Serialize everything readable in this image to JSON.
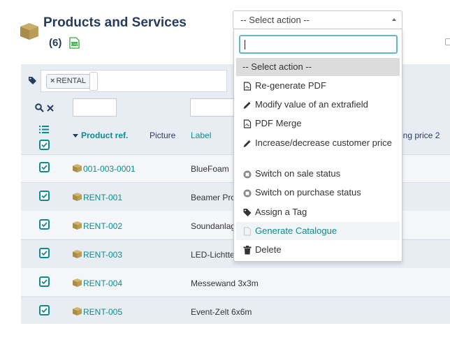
{
  "page": {
    "title": "Products and Services",
    "count": "(6)"
  },
  "select_action": {
    "placeholder": "-- Select action --"
  },
  "dropdown": {
    "items": [
      {
        "label": "-- Select action --",
        "icon": "none"
      },
      {
        "label": "Re-generate PDF",
        "icon": "pdf-file-icon"
      },
      {
        "label": "Modify value of an extrafield",
        "icon": "pencil-icon"
      },
      {
        "label": "PDF Merge",
        "icon": "pdf-file-icon"
      },
      {
        "label": "Increase/decrease customer price",
        "icon": "pencil-icon"
      },
      {
        "label": "Switch on sale status",
        "icon": "toggle-circle-icon"
      },
      {
        "label": "Switch on purchase status",
        "icon": "toggle-circle-icon"
      },
      {
        "label": "Assign a Tag",
        "icon": "tag-icon"
      },
      {
        "label": "Generate Catalogue",
        "icon": "file-icon"
      },
      {
        "label": "Delete",
        "icon": "trash-icon"
      }
    ]
  },
  "filters": {
    "tag_chip": "RENTAL",
    "tag_chip_remove": "×"
  },
  "table": {
    "headers": {
      "ref": "Product ref.",
      "picture": "Picture",
      "label": "Label",
      "price": "ing price 2"
    },
    "rows": [
      {
        "ref": "001-003-0001",
        "label": "BlueFoam"
      },
      {
        "ref": "RENT-001",
        "label": "Beamer Pro"
      },
      {
        "ref": "RENT-002",
        "label": "Soundanlag"
      },
      {
        "ref": "RENT-003",
        "label": "LED-Lichtte"
      },
      {
        "ref": "RENT-004",
        "label": "Messewand 3x3m"
      },
      {
        "ref": "RENT-005",
        "label": "Event-Zelt 6x6m"
      }
    ]
  },
  "colors": {
    "accent": "#0f8b8d",
    "title": "#263c5c",
    "panel": "#e8edf4",
    "product_icon": "#b89a52"
  }
}
